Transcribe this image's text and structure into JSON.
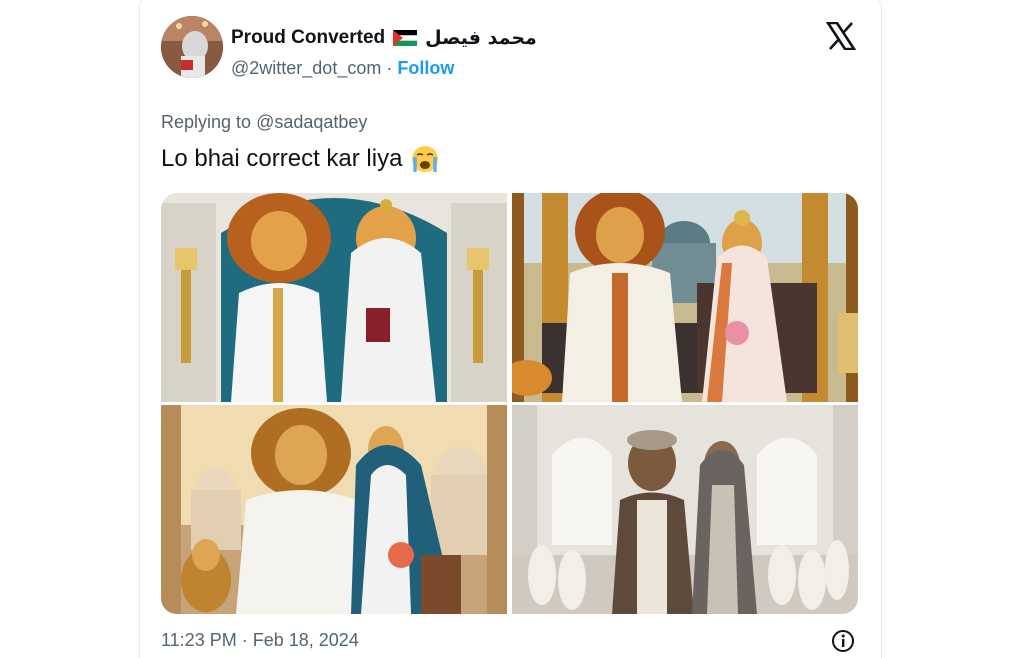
{
  "tweet": {
    "display_name": "Proud Converted",
    "arabic_name": "محمد فيصل",
    "handle": "@2witter_dot_com",
    "separator": "·",
    "follow_label": "Follow",
    "replying_prefix": "Replying to",
    "replying_to": "@sadaqatbey",
    "text": "Lo bhai correct kar liya",
    "timestamp": "11:23 PM · Feb 18, 2024",
    "icons": {
      "flag": "palestine-flag-icon",
      "emoji": "loudly-crying-face-icon",
      "platform": "x-logo-icon",
      "info": "info-icon"
    },
    "colors": {
      "link": "#1d9bf0",
      "secondary_text": "#536471",
      "primary_text": "#0f1419"
    },
    "media_count": 4
  }
}
